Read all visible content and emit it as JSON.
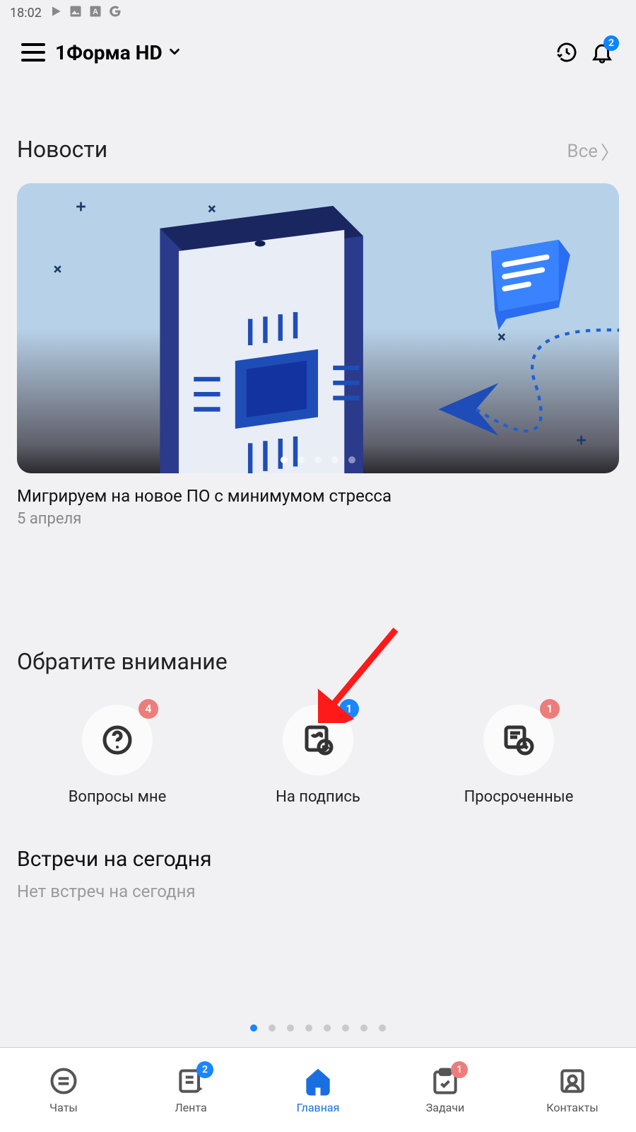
{
  "status": {
    "time": "18:02"
  },
  "header": {
    "title": "1Форма HD",
    "bell_badge": "2"
  },
  "news": {
    "section_title": "Новости",
    "all_label": "Все",
    "headline": "Мигрируем на новое ПО с минимумом стресса",
    "date": "5 апреля",
    "carousel_count": 5,
    "carousel_active": 0
  },
  "attention": {
    "section_title": "Обратите внимание",
    "items": [
      {
        "label": "Вопросы мне",
        "badge": "4",
        "badge_color": "red",
        "icon": "question"
      },
      {
        "label": "На подпись",
        "badge": "1",
        "badge_color": "blue",
        "icon": "sign"
      },
      {
        "label": "Просроченные",
        "badge": "1",
        "badge_color": "red",
        "icon": "overdue"
      }
    ]
  },
  "meetings": {
    "title": "Встречи на сегодня",
    "empty": "Нет встреч на сегодня"
  },
  "pager": {
    "count": 8,
    "active": 0
  },
  "nav": {
    "items": [
      {
        "label": "Чаты",
        "icon": "chat",
        "badge": null,
        "badge_color": null,
        "active": false
      },
      {
        "label": "Лента",
        "icon": "feed",
        "badge": "2",
        "badge_color": "blue",
        "active": false
      },
      {
        "label": "Главная",
        "icon": "home",
        "badge": null,
        "badge_color": null,
        "active": true
      },
      {
        "label": "Задачи",
        "icon": "tasks",
        "badge": "1",
        "badge_color": "red",
        "active": false
      },
      {
        "label": "Контакты",
        "icon": "contacts",
        "badge": null,
        "badge_color": null,
        "active": false
      }
    ]
  }
}
